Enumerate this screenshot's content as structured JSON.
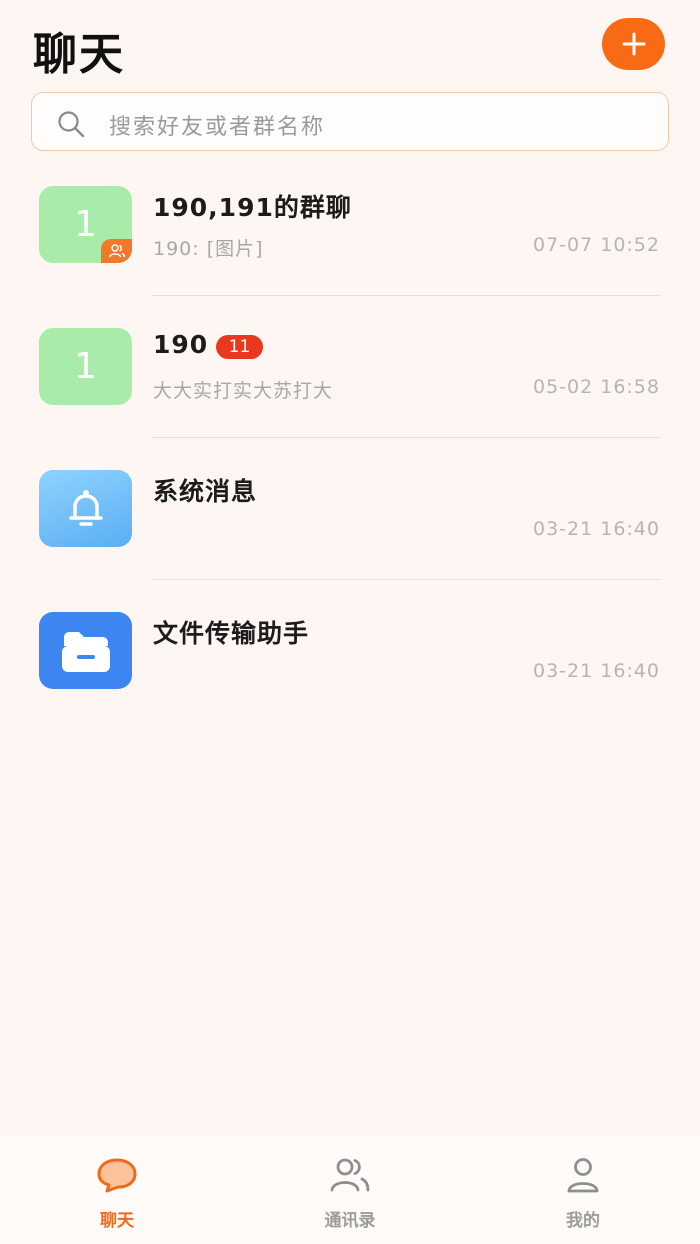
{
  "header": {
    "title": "聊天"
  },
  "search": {
    "placeholder": "搜索好友或者群名称"
  },
  "chats": [
    {
      "avatar_text": "1",
      "avatar_type": "group",
      "name": "190,191的群聊",
      "preview": "190: [图片]",
      "time": "07-07 10:52"
    },
    {
      "avatar_text": "1",
      "avatar_type": "user",
      "name": "190",
      "unread": "11",
      "preview": "大大实打实大苏打大",
      "time": "05-02 16:58"
    },
    {
      "avatar_type": "bell-icon",
      "name": "系统消息",
      "preview": "",
      "time": "03-21 16:40"
    },
    {
      "avatar_type": "folder-icon",
      "name": "文件传输助手",
      "preview": "",
      "time": "03-21 16:40"
    }
  ],
  "tabbar": {
    "tabs": [
      {
        "label": "聊天",
        "icon": "chat-bubble-icon",
        "active": true
      },
      {
        "label": "通讯录",
        "icon": "contacts-icon",
        "active": false
      },
      {
        "label": "我的",
        "icon": "profile-icon",
        "active": false
      }
    ]
  },
  "colors": {
    "accent": "#f96a14",
    "unread_badge": "#e8391e",
    "avatar_green": "#a9ecaa",
    "folder_blue": "#3d86f2"
  }
}
